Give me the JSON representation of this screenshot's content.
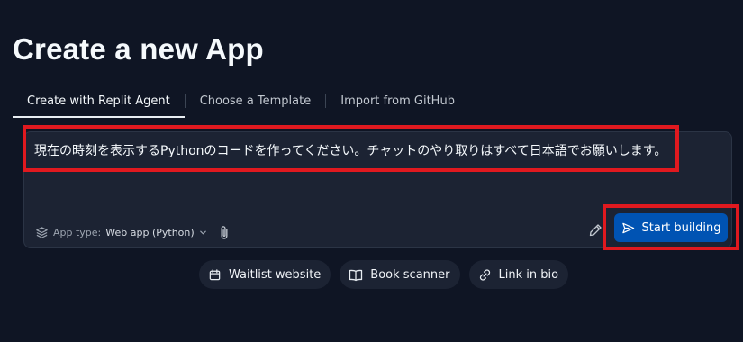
{
  "page": {
    "title": "Create a new App"
  },
  "tabs": [
    {
      "label": "Create with Replit Agent",
      "active": true
    },
    {
      "label": "Choose a Template",
      "active": false
    },
    {
      "label": "Import from GitHub",
      "active": false
    }
  ],
  "prompt": {
    "text": "現在の時刻を表示するPythonのコードを作ってください。チャットのやり取りはすべて日本語でお願いします。"
  },
  "app_type": {
    "label": "App type:",
    "value": "Web app (Python)",
    "icon": "layers-icon"
  },
  "start_button": {
    "label": "Start building",
    "icon": "send-icon",
    "color": "#0053b3"
  },
  "suggestions": [
    {
      "label": "Waitlist website",
      "icon": "calendar-icon"
    },
    {
      "label": "Book scanner",
      "icon": "book-icon"
    },
    {
      "label": "Link in bio",
      "icon": "link-icon"
    }
  ],
  "colors": {
    "background": "#0f1524",
    "panel": "#1c2333",
    "highlight": "#e0191f"
  }
}
